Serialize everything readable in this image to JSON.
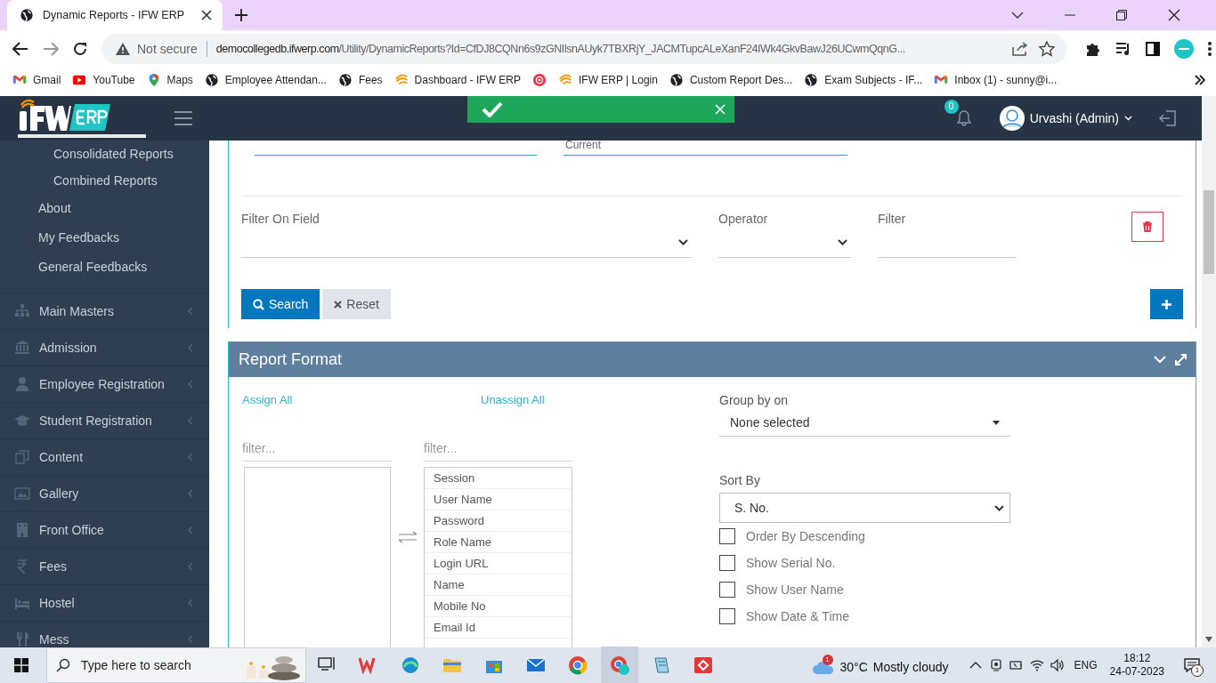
{
  "browser": {
    "tab_title": "Dynamic Reports - IFW ERP",
    "security": "Not secure",
    "url_host": "democollegedb.ifwerp.com",
    "url_path": "/Utility/DynamicReports?Id=CfDJ8CQNn6s9zGNIlsnAUyk7TBXRjY_JACMTupcALeXanF24IWk4GkvBawJ26UCwmQqnG...",
    "bookmarks": [
      {
        "kind": "gmail",
        "label": "Gmail"
      },
      {
        "kind": "youtube",
        "label": "YouTube"
      },
      {
        "kind": "maps",
        "label": "Maps"
      },
      {
        "kind": "globe",
        "label": "Employee Attendan..."
      },
      {
        "kind": "globe",
        "label": "Fees"
      },
      {
        "kind": "ifw",
        "label": "Dashboard - IFW ERP"
      },
      {
        "kind": "record"
      },
      {
        "kind": "ifw",
        "label": "IFW ERP | Login"
      },
      {
        "kind": "globe",
        "label": "Custom Report Des..."
      },
      {
        "kind": "globe",
        "label": "Exam Subjects - IF..."
      },
      {
        "kind": "gmail",
        "label": "Inbox (1) - sunny@i..."
      }
    ]
  },
  "header": {
    "notification_count": "0",
    "user": "Urvashi (Admin)"
  },
  "sidebar": {
    "nested_items": [
      "Consolidated Reports",
      "Combined Reports"
    ],
    "items": [
      "About",
      "My Feedbacks",
      "General Feedbacks"
    ],
    "menu": [
      {
        "kind": "sitemap",
        "label": "Main Masters"
      },
      {
        "kind": "bank",
        "label": "Admission"
      },
      {
        "kind": "user",
        "label": "Employee Registration"
      },
      {
        "kind": "cap",
        "label": "Student Registration"
      },
      {
        "kind": "copy",
        "label": "Content"
      },
      {
        "kind": "image",
        "label": "Gallery"
      },
      {
        "kind": "building",
        "label": "Front Office"
      },
      {
        "kind": "rupee",
        "label": "Fees"
      },
      {
        "kind": "bed",
        "label": "Hostel"
      },
      {
        "kind": "cutlery",
        "label": "Mess"
      }
    ]
  },
  "filters": {
    "session_value": "Current",
    "field_label": "Filter On Field",
    "operator_label": "Operator",
    "filter_label": "Filter",
    "search_button": "Search",
    "reset_button": "Reset"
  },
  "report_format": {
    "title": "Report Format",
    "assign_all": "Assign All",
    "unassign_all": "Unassign All",
    "available_placeholder": "filter...",
    "assigned_placeholder": "filter...",
    "assigned_fields": [
      "Session",
      "User Name",
      "Password",
      "Role Name",
      "Login URL",
      "Name",
      "Mobile No",
      "Email Id"
    ],
    "group_by_label": "Group by on",
    "group_by_value": "None selected",
    "sort_by_label": "Sort By",
    "sort_by_value": "S. No.",
    "options": [
      {
        "label": "Order By Descending",
        "checked": false
      },
      {
        "label": "Show Serial No.",
        "checked": false
      },
      {
        "label": "Show User Name",
        "checked": false
      },
      {
        "label": "Show Date & Time",
        "checked": false
      }
    ]
  },
  "taskbar": {
    "search_placeholder": "Type here to search",
    "weather_badge": "1",
    "temperature": "30°C",
    "weather": "Mostly cloudy",
    "language": "ENG",
    "time": "18:12",
    "date": "24-07-2023",
    "notification_badge": "1"
  }
}
